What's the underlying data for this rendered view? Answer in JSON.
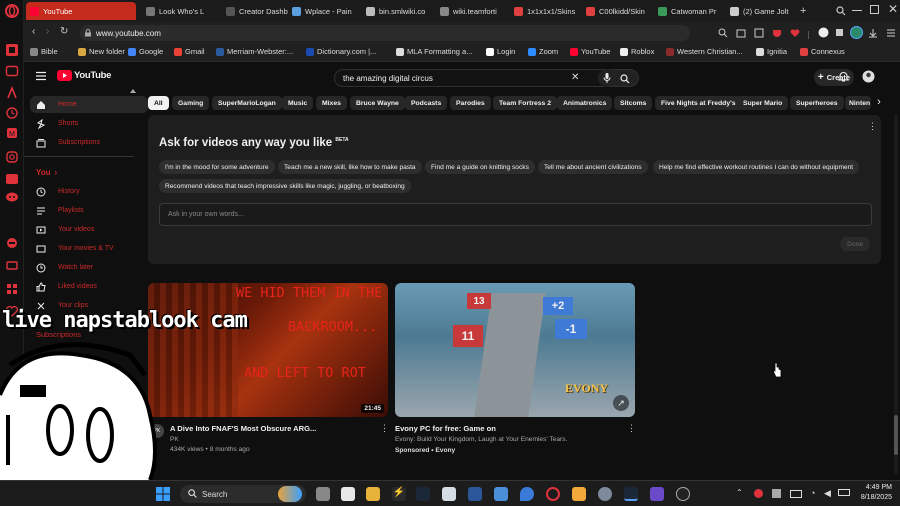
{
  "browser": {
    "tabs": [
      {
        "label": "YouTube",
        "active": true
      },
      {
        "label": "Look Who's L"
      },
      {
        "label": "Creator Dashb"
      },
      {
        "label": "Wplace - Pain"
      },
      {
        "label": "bin.smlwiki.co"
      },
      {
        "label": "wiki.teamforti"
      },
      {
        "label": "1x1x1x1/Skins"
      },
      {
        "label": "C00lkidd/Skin"
      },
      {
        "label": "Catwoman Pr"
      },
      {
        "label": "(2) Game Jolt"
      }
    ],
    "url": "www.youtube.com",
    "bookmarks": [
      "Bible",
      "New folder",
      "Google",
      "Gmail",
      "Merriam-Webster:...",
      "Dictionary.com |...",
      "MLA Formatting a...",
      "Login",
      "Zoom",
      "YouTube",
      "Roblox",
      "Western Christian...",
      "Ignitia",
      "Connexus"
    ]
  },
  "youtube": {
    "logo": "YouTube",
    "search_value": "the amazing digital circus",
    "create_label": "Create",
    "sidebar": {
      "main": [
        "Home",
        "Shorts",
        "Subscriptions"
      ],
      "you_heading": "You",
      "you": [
        "History",
        "Playlists",
        "Your videos",
        "Your movies & TV",
        "Watch later",
        "Liked videos",
        "Your clips"
      ],
      "subs_heading": "Subscriptions"
    },
    "chips": [
      "All",
      "Gaming",
      "SuperMarioLogan",
      "Music",
      "Mixes",
      "Bruce Wayne",
      "Podcasts",
      "Parodies",
      "Team Fortress 2",
      "Animatronics",
      "Sitcoms",
      "Five Nights at Freddy's",
      "Super Mario",
      "Superheroes",
      "Ninten"
    ],
    "ask": {
      "title": "Ask for videos any way you like",
      "badge": "BETA",
      "prompts": [
        "I'm in the mood for some adventure",
        "Teach me a new skill, like how to make pasta",
        "Find me a guide on knitting socks",
        "Tell me about ancient civilizations",
        "Help me find effective workout routines I can do without equipment",
        "Recommend videos that teach impressive skills like magic, juggling, or beatboxing"
      ],
      "placeholder": "Ask in your own words...",
      "done_label": "Done"
    },
    "videos": [
      {
        "thumb_lines": [
          "WE HID THEM IN THE",
          "BACKROOM...",
          "AND LEFT TO ROT"
        ],
        "duration": "21:45",
        "title": "A Dive Into FNAF'S Most Obscure ARG...",
        "channel": "PK",
        "meta": "434K views • 8 months ago",
        "avatar": "PK"
      },
      {
        "thumb_numbers": [
          "13",
          "+2",
          "-1",
          "11"
        ],
        "thumb_brand": "EVONY",
        "title": "Evony PC for free: Game on",
        "channel": "Evony: Build Your Kingdom, Laugh at Your Enemies' Tears.",
        "meta": "Sponsored • Evony"
      }
    ]
  },
  "overlay": {
    "caption": "live napstablook cam"
  },
  "taskbar": {
    "search_label": "Search",
    "time": "4:49 PM",
    "date": "8/18/2025"
  },
  "colors": {
    "accent": "#c42b1c",
    "yt_red": "#ff0033",
    "bg": "#0f0f0f"
  }
}
